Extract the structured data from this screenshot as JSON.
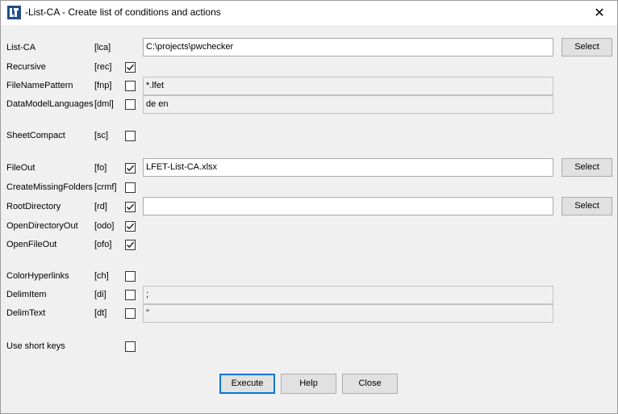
{
  "window": {
    "title": "-List-CA - Create list of conditions and actions",
    "close_glyph": "✕"
  },
  "rows": [
    {
      "label": "List-CA",
      "key": "[lca]"
    },
    {
      "label": "Recursive",
      "key": "[rec]",
      "checked": true
    },
    {
      "label": "FileNamePattern",
      "key": "[fnp]",
      "checked": false
    },
    {
      "label": "DataModelLanguages",
      "key": "[dml]",
      "checked": false
    },
    {
      "label": "SheetCompact",
      "key": "[sc]",
      "checked": false
    },
    {
      "label": "FileOut",
      "key": "[fo]",
      "checked": true
    },
    {
      "label": "CreateMissingFolders",
      "key": "[crmf]",
      "checked": false
    },
    {
      "label": "RootDirectory",
      "key": "[rd]",
      "checked": true
    },
    {
      "label": "OpenDirectoryOut",
      "key": "[odo]",
      "checked": true
    },
    {
      "label": "OpenFileOut",
      "key": "[ofo]",
      "checked": true
    },
    {
      "label": "ColorHyperlinks",
      "key": "[ch]",
      "checked": false
    },
    {
      "label": "DelimItem",
      "key": "[di]",
      "checked": false
    },
    {
      "label": "DelimText",
      "key": "[dt]",
      "checked": false
    },
    {
      "label": "Use short keys",
      "key": "",
      "checked": false
    }
  ],
  "fields": {
    "list_ca": "C:\\projects\\pwchecker",
    "file_name_pattern": "*.lfet",
    "data_model_languages": "de en",
    "file_out": "LFET-List-CA.xlsx",
    "root_directory": "",
    "delim_item": ";",
    "delim_text": "\""
  },
  "buttons": {
    "select": "Select",
    "execute": "Execute",
    "help": "Help",
    "close": "Close"
  },
  "colors": {
    "focus_border": "#0078d7",
    "icon_blue": "#1f4e8c"
  }
}
